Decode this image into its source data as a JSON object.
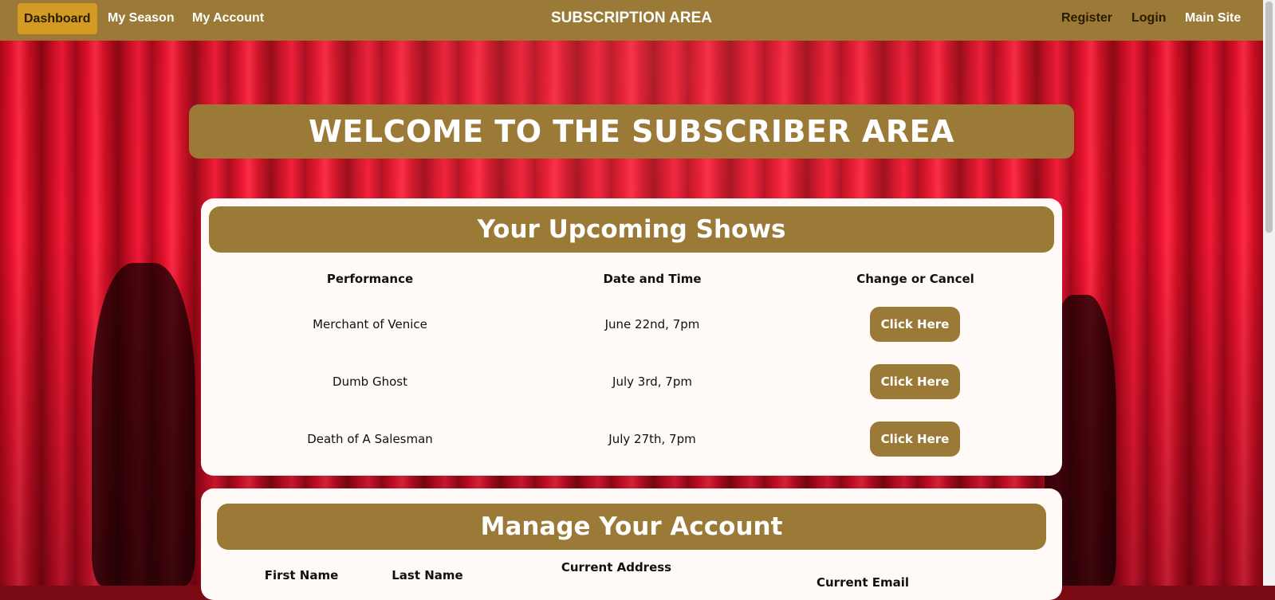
{
  "nav": {
    "dashboard": "Dashboard",
    "my_season": "My Season",
    "my_account": "My Account",
    "title": "SUBSCRIPTION AREA",
    "register": "Register",
    "login": "Login",
    "main_site": "Main Site"
  },
  "banner": {
    "title": "WELCOME TO THE SUBSCRIBER AREA"
  },
  "shows": {
    "heading": "Your Upcoming Shows",
    "columns": [
      "Performance",
      "Date and Time",
      "Change or Cancel"
    ],
    "rows": [
      {
        "performance": "Merchant of Venice",
        "date": "June 22nd, 7pm",
        "action": "Click Here"
      },
      {
        "performance": "Dumb Ghost",
        "date": "July 3rd, 7pm",
        "action": "Click Here"
      },
      {
        "performance": "Death of A Salesman",
        "date": "July 27th, 7pm",
        "action": "Click Here"
      }
    ]
  },
  "account": {
    "heading": "Manage Your Account",
    "columns": [
      "First Name",
      "Last Name",
      "Current Address",
      "Current Email"
    ]
  },
  "colors": {
    "nav_bg": "#9b7a38",
    "active_tab": "#d39b24",
    "card_bg": "#fffaf8",
    "curtain": "#e5122c"
  }
}
